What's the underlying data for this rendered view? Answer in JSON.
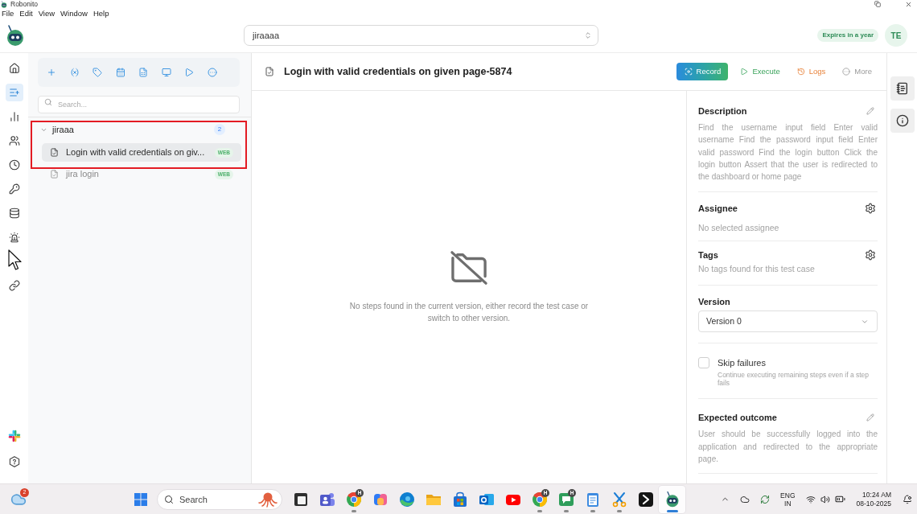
{
  "window": {
    "title": "Robonito",
    "menu": [
      "File",
      "Edit",
      "View",
      "Window",
      "Help"
    ]
  },
  "header": {
    "project": "jiraaaa",
    "license": "Expires in a year",
    "avatar": "TE"
  },
  "nav": [
    {
      "kind": "home",
      "selected": false
    },
    {
      "kind": "tests",
      "selected": true
    },
    {
      "kind": "reports",
      "selected": false
    },
    {
      "kind": "users",
      "selected": false
    },
    {
      "kind": "history",
      "selected": false
    },
    {
      "kind": "keys",
      "selected": false
    },
    {
      "kind": "data",
      "selected": false
    },
    {
      "kind": "alerts",
      "selected": false
    },
    {
      "kind": "integrations",
      "selected": false
    }
  ],
  "explorer": {
    "search": {
      "placeholder": "Search..."
    },
    "folders": [
      {
        "name": "jiraaa",
        "count": "2",
        "expanded": true,
        "children": [
          {
            "name": "Login with valid credentials on giv...",
            "badge": "WEB",
            "selected": true
          },
          {
            "name": "jira login",
            "badge": "WEB",
            "selected": false
          }
        ]
      }
    ]
  },
  "test_case": {
    "title": "Login with valid credentials on given page-5874",
    "actions": [
      {
        "kind": "record",
        "label": "Record"
      },
      {
        "kind": "execute",
        "label": "Execute"
      },
      {
        "kind": "logs",
        "label": "Logs"
      },
      {
        "kind": "more",
        "label": "More"
      }
    ],
    "empty_state": {
      "message": "No steps found in the current version, either record the test case or switch to other version."
    }
  },
  "details": {
    "description": {
      "label": "Description",
      "text": "Find the username input field Enter valid username Find the password input field Enter valid password Find the login button Click the login button Assert that the user is redirected to the dashboard or home page"
    },
    "assignee": {
      "label": "Assignee",
      "value": "No selected assignee"
    },
    "tags": {
      "label": "Tags",
      "value": "No tags found for this test case"
    },
    "version": {
      "label": "Version",
      "value": "Version 0"
    },
    "skip_failures": {
      "label": "Skip failures",
      "hint": "Continue executing remaining steps even if a step fails",
      "checked": false
    },
    "expected_outcome": {
      "label": "Expected outcome",
      "text": "User should be successfully logged into the application and redirected to the appropriate page."
    }
  },
  "taskbar": {
    "weather_badge": "2",
    "search": {
      "placeholder": "Search"
    },
    "apps": [
      {
        "kind": "window",
        "open": false,
        "selected": false
      },
      {
        "kind": "people",
        "open": false,
        "selected": false
      },
      {
        "kind": "browser",
        "badge": "H",
        "open": true,
        "selected": false
      },
      {
        "kind": "sparkle",
        "open": false,
        "selected": false
      },
      {
        "kind": "globe",
        "open": false,
        "selected": false
      },
      {
        "kind": "folder",
        "open": false,
        "selected": false
      },
      {
        "kind": "store",
        "open": false,
        "selected": false
      },
      {
        "kind": "mail",
        "open": false,
        "selected": false
      },
      {
        "kind": "video",
        "open": false,
        "selected": false
      },
      {
        "kind": "browser",
        "badge": "H",
        "open": true,
        "selected": false
      },
      {
        "kind": "chat",
        "badge": "H",
        "open": true,
        "selected": false
      },
      {
        "kind": "notepad",
        "open": true,
        "selected": false
      },
      {
        "kind": "scissors",
        "open": true,
        "selected": false
      },
      {
        "kind": "arrow",
        "open": false,
        "selected": false
      },
      {
        "kind": "robot",
        "open": true,
        "selected": true
      }
    ],
    "tray": {
      "language": "ENG",
      "region": "IN",
      "time": "10:24 AM",
      "date": "08-10-2025"
    }
  }
}
